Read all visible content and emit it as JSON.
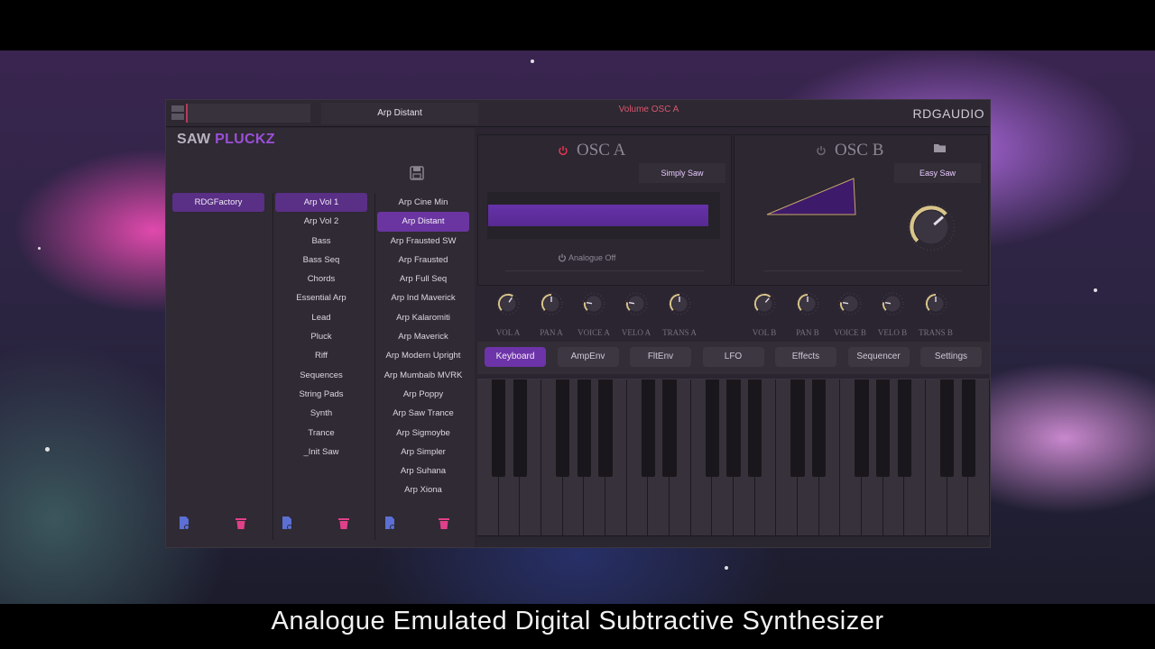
{
  "caption": "Analogue Emulated Digital Subtractive Synthesizer",
  "topbar": {
    "preset_name": "Arp Distant",
    "param_display": "Volume OSC A",
    "brand": "RDGAUDIO"
  },
  "logo": {
    "part1": "SAW",
    "part2": "PLUCKZ"
  },
  "browser": {
    "banks": [
      {
        "label": "RDGFactory",
        "selected": true
      }
    ],
    "categories": [
      {
        "label": "Arp Vol 1",
        "selected": true
      },
      {
        "label": "Arp Vol 2"
      },
      {
        "label": "Bass"
      },
      {
        "label": "Bass Seq"
      },
      {
        "label": "Chords"
      },
      {
        "label": "Essential Arp"
      },
      {
        "label": "Lead"
      },
      {
        "label": "Pluck"
      },
      {
        "label": "Riff"
      },
      {
        "label": "Sequences"
      },
      {
        "label": "String Pads"
      },
      {
        "label": "Synth"
      },
      {
        "label": "Trance"
      },
      {
        "label": "_Init Saw"
      }
    ],
    "presets": [
      {
        "label": "Arp Cine Min"
      },
      {
        "label": "Arp Distant",
        "selected": true
      },
      {
        "label": "Arp Frausted SW"
      },
      {
        "label": "Arp Frausted"
      },
      {
        "label": "Arp Full Seq"
      },
      {
        "label": "Arp Ind Maverick"
      },
      {
        "label": "Arp Kalaromiti"
      },
      {
        "label": "Arp Maverick"
      },
      {
        "label": "Arp Modern Upright"
      },
      {
        "label": "Arp Mumbaib MVRK"
      },
      {
        "label": "Arp Poppy"
      },
      {
        "label": "Arp Saw Trance"
      },
      {
        "label": "Arp Sigmoybe"
      },
      {
        "label": "Arp Simpler"
      },
      {
        "label": "Arp Suhana"
      },
      {
        "label": "Arp Xiona"
      }
    ]
  },
  "oscA": {
    "title": "OSC A",
    "wave": "Simply Saw",
    "analogue": "Analogue Off",
    "power_color": "#d8364f",
    "knobs": [
      {
        "label": "VOL A",
        "value": 0.62
      },
      {
        "label": "PAN A",
        "value": 0.5
      },
      {
        "label": "VOICE A",
        "value": 0.2
      },
      {
        "label": "VELO A",
        "value": 0.2
      },
      {
        "label": "TRANS A",
        "value": 0.5
      }
    ]
  },
  "oscB": {
    "title": "OSC B",
    "wave": "Easy Saw",
    "power_color": "#6a6470",
    "knobs": [
      {
        "label": "VOL B",
        "value": 0.65
      },
      {
        "label": "PAN B",
        "value": 0.5
      },
      {
        "label": "VOICE B",
        "value": 0.2
      },
      {
        "label": "VELO B",
        "value": 0.2
      },
      {
        "label": "TRANS B",
        "value": 0.5
      }
    ],
    "big_knob_value": 0.68
  },
  "tabs": [
    {
      "label": "Keyboard",
      "active": true
    },
    {
      "label": "AmpEnv"
    },
    {
      "label": "FltEnv"
    },
    {
      "label": "LFO"
    },
    {
      "label": "Effects"
    },
    {
      "label": "Sequencer"
    },
    {
      "label": "Settings"
    }
  ],
  "colors": {
    "accent": "#6d33a8",
    "knob_ring": "#d9c58a",
    "param_text": "#d9566e"
  }
}
